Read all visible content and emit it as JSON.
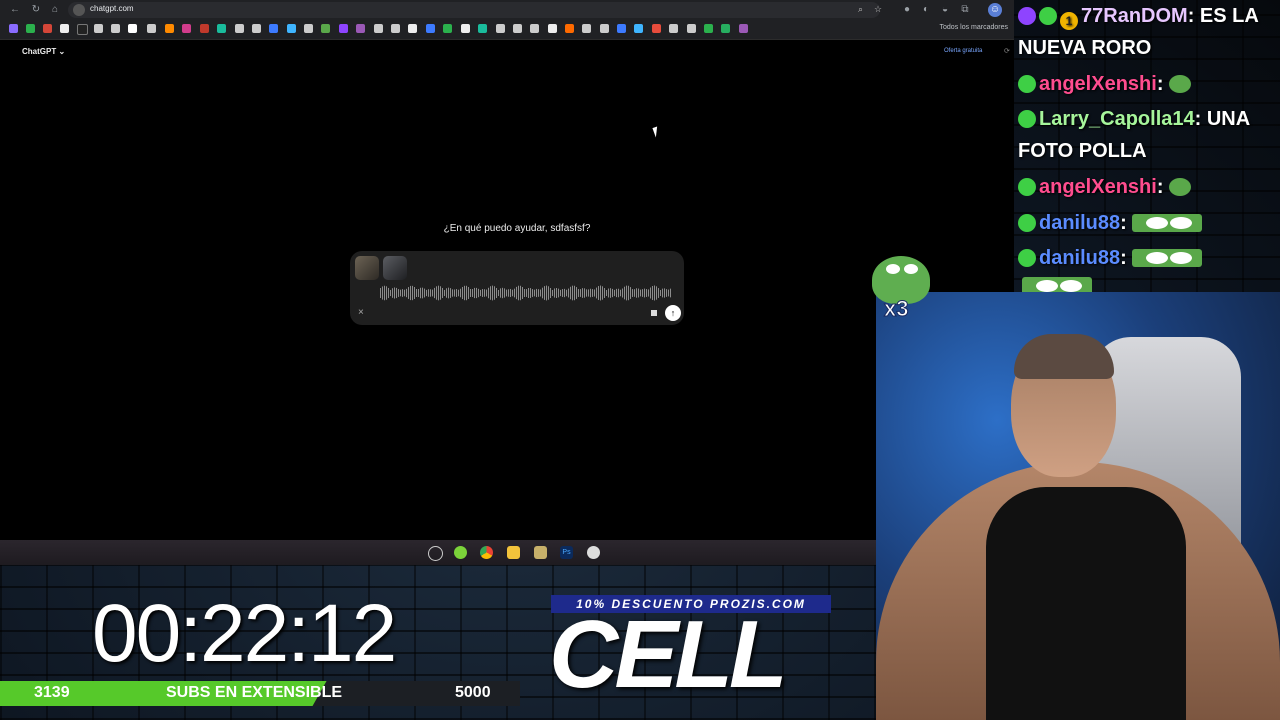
{
  "browser": {
    "url": "chatgpt.com",
    "bookmarks_folder": "Todos los marcadores",
    "accent": "#202124"
  },
  "chatgpt": {
    "model_label": "ChatGPT ⌄",
    "promo_link": "Oferta gratuita",
    "greeting": "¿En qué puedo ayudar, sdfasfsf?",
    "cancel_icon": "×",
    "send_icon": "↑"
  },
  "chat": {
    "messages": [
      {
        "user": "77RanDOM",
        "user_color": "#e7c7ff",
        "text": ": ES LA NUEVA RORO",
        "badges": [
          "purple",
          "green",
          "gold"
        ]
      },
      {
        "user": "angelXenshi",
        "user_color": "#ff4d8f",
        "text": ":",
        "emote": "pepe"
      },
      {
        "user": "Larry_Capolla14",
        "user_color": "#a6f59b",
        "text": ": UNA FOTO POLLA"
      },
      {
        "user": "angelXenshi",
        "user_color": "#ff4d8f",
        "text": ":",
        "emote": "pepe"
      },
      {
        "user": "danilu88",
        "user_color": "#5b8cff",
        "text": ":",
        "emote": "eyes"
      },
      {
        "user": "danilu88",
        "user_color": "#5b8cff",
        "text": ":",
        "emote": "eyes"
      }
    ],
    "combo_text": "x3"
  },
  "stream": {
    "timer": "00:22:12",
    "subs_current": "3139",
    "subs_label": "SUBS EN EXTENSIBLE",
    "subs_goal": "5000",
    "subs_progress": 0.628,
    "subs_color": "#56c92a"
  },
  "sponsor": {
    "promo": "10% DESCUENTO PROZIS.COM",
    "logo": "CELL"
  }
}
